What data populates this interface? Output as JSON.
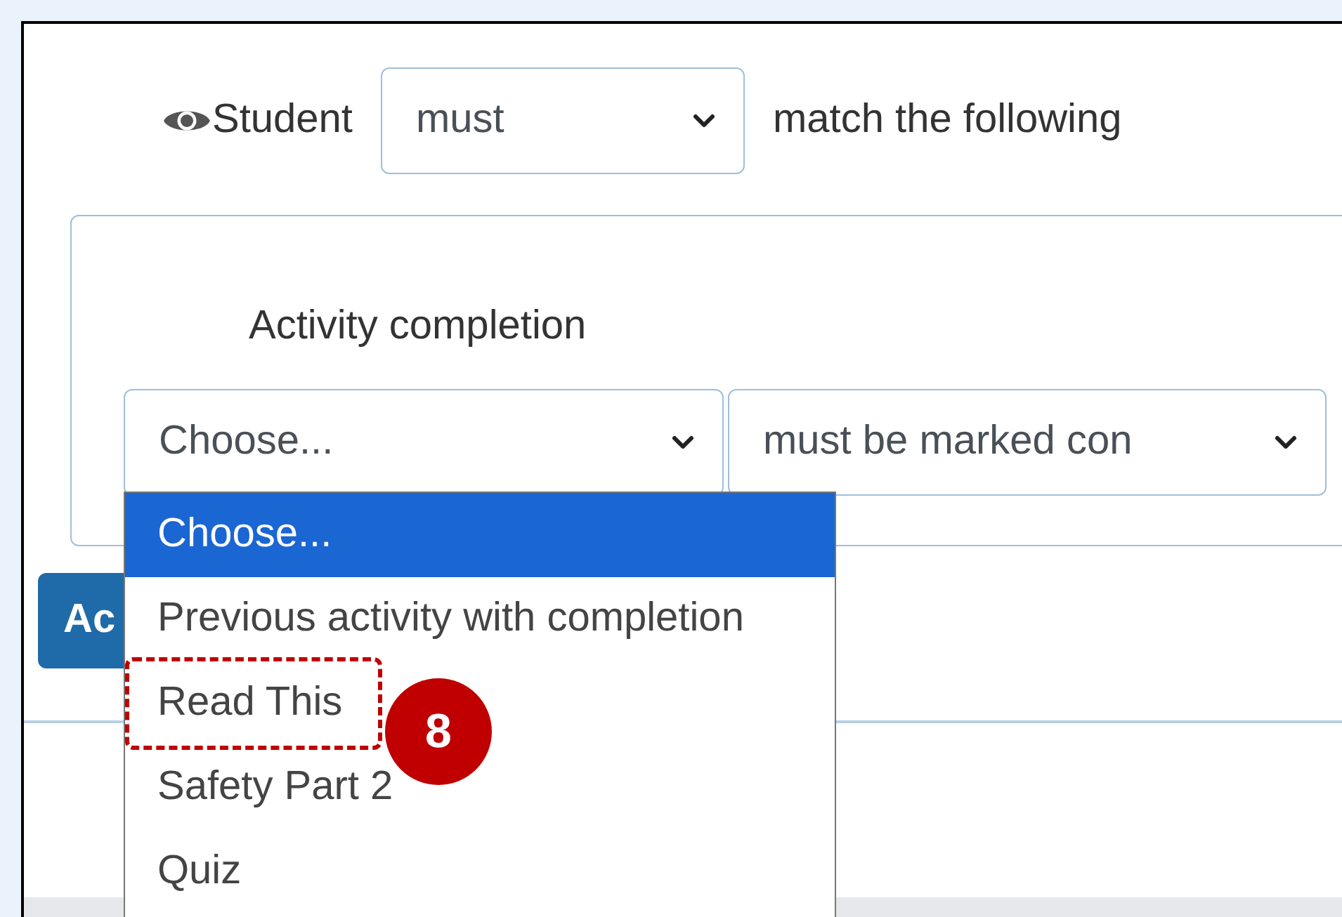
{
  "condition": {
    "prefix": "Student",
    "mode_select": {
      "value": "must"
    },
    "suffix": "match the following"
  },
  "restriction": {
    "title": "Activity completion",
    "activity_select": {
      "value": "Choose..."
    },
    "state_select": {
      "value": "must be marked con"
    }
  },
  "add_button": {
    "label": "Ac"
  },
  "dropdown": {
    "options": [
      {
        "label": "Choose...",
        "selected": true,
        "highlighted": false
      },
      {
        "label": "Previous activity with completion",
        "selected": false,
        "highlighted": false
      },
      {
        "label": "Read This",
        "selected": false,
        "highlighted": true
      },
      {
        "label": "Safety Part 2",
        "selected": false,
        "highlighted": false
      },
      {
        "label": "Quiz",
        "selected": false,
        "highlighted": false
      }
    ]
  },
  "callout": {
    "number": "8"
  }
}
